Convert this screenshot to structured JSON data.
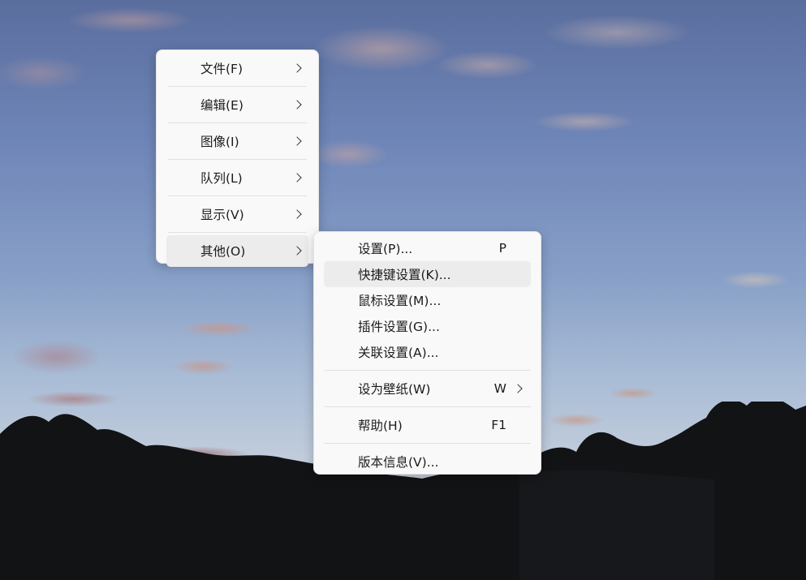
{
  "main_menu": {
    "items": [
      {
        "label": "文件(F)"
      },
      {
        "label": "编辑(E)"
      },
      {
        "label": "图像(I)"
      },
      {
        "label": "队列(L)"
      },
      {
        "label": "显示(V)"
      },
      {
        "label": "其他(O)"
      }
    ]
  },
  "sub_menu": {
    "items": [
      {
        "label": "设置(P)...",
        "accel": "P"
      },
      {
        "label": "快捷键设置(K)..."
      },
      {
        "label": "鼠标设置(M)..."
      },
      {
        "label": "插件设置(G)..."
      },
      {
        "label": "关联设置(A)..."
      },
      {
        "label": "设为壁纸(W)",
        "accel": "W"
      },
      {
        "label": "帮助(H)",
        "accel": "F1"
      },
      {
        "label": "版本信息(V)..."
      }
    ]
  },
  "icons": {
    "submenu_arrow": "chevron-right-icon"
  },
  "colors": {
    "menu_bg": "#f9f9f9",
    "highlight": "#ececec",
    "text": "#1c1c1c",
    "separator": "#e1e1e1"
  }
}
